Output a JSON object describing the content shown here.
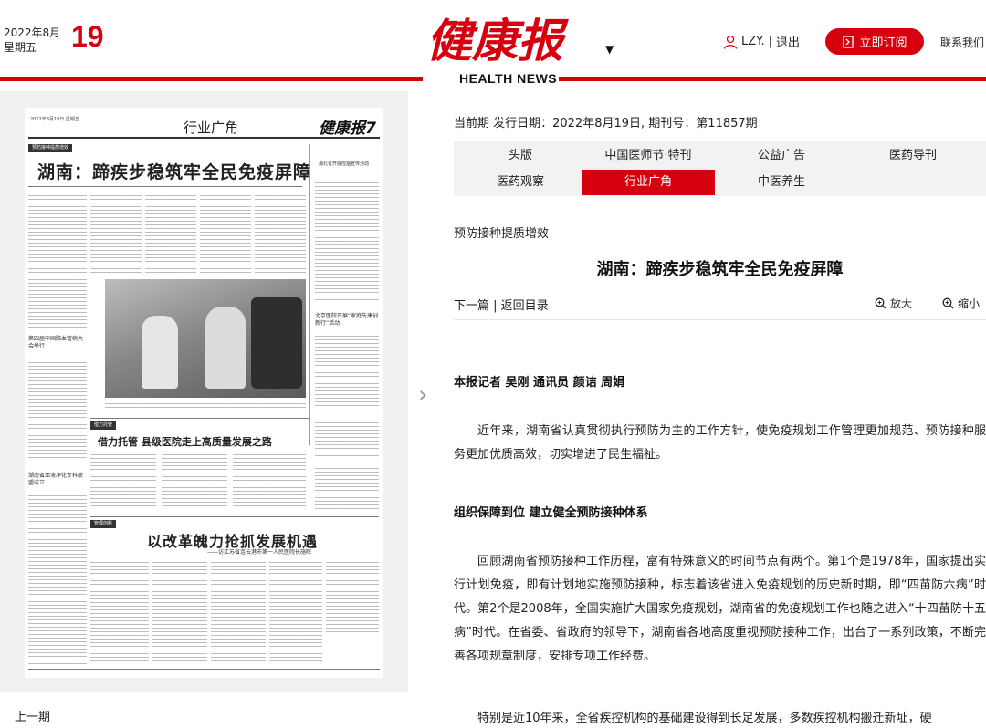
{
  "header": {
    "year_month": "2022年8月",
    "weekday": "星期五",
    "day": "19",
    "logo_text": "健康报",
    "logo_sub": "HEALTH NEWS",
    "user": "LZY.",
    "logout": "退出",
    "subscribe": "立即订阅",
    "contact": "联系我们",
    "accent": "#d7000f"
  },
  "paper": {
    "date": "2022年8月19日 星期五",
    "section": "行业广角",
    "masthead": "健康报",
    "page_no": "7",
    "tag1": "预防接种提质增效",
    "headline1": "湖南：蹄疾步稳筑牢全民免疫屏障",
    "tag2": "借力托管",
    "headline2": "借力托管 县级医院走上高质量发展之路",
    "tag3": "管理创新",
    "headline3": "以改革魄力抢抓发展机遇",
    "subhead3": "——访江苏省连云港市第一人民医院长施晖",
    "side1": "湖北省开展控烟宣传活动",
    "side2": "第四届中国脑血管病大会举行",
    "side3": "湖南省血液净化专科联盟成立",
    "side4": "北京医院开展“家庭先康创新行”活动"
  },
  "left": {
    "prev_issue": "上一期"
  },
  "content": {
    "issue_line": "当前期 发行日期：2022年8月19日, 期刊号：第11857期",
    "tabs": [
      {
        "label": "头版",
        "active": false
      },
      {
        "label": "中国医师节·特刊",
        "active": false
      },
      {
        "label": "公益广告",
        "active": false
      },
      {
        "label": "医药导刊",
        "active": false
      },
      {
        "label": "医药观察",
        "active": false
      },
      {
        "label": "行业广角",
        "active": true
      },
      {
        "label": "中医养生",
        "active": false
      }
    ],
    "subtitle": "预防接种提质增效",
    "title": "湖南：蹄疾步稳筑牢全民免疫屏障",
    "next": "下一篇",
    "back": "返回目录",
    "zoom_in": "放大",
    "zoom_out": "缩小",
    "author": "本报记者  吴刚  通讯员  颜诘  周娟",
    "para1": "近年来，湖南省认真贯彻执行预防为主的工作方针，使免疫规划工作管理更加规范、预防接种服务更加优质高效，切实增进了民生福祉。",
    "section1": "组织保障到位  建立健全预防接种体系",
    "para2": "回顾湖南省预防接种工作历程，富有特殊意义的时间节点有两个。第1个是1978年，国家提出实行计划免疫，即有计划地实施预防接种，标志着该省进入免疫规划的历史新时期，即“四苗防六病”时代。第2个是2008年，全国实施扩大国家免疫规划，湖南省的免疫规划工作也随之进入“十四苗防十五病”时代。在省委、省政府的领导下，湖南省各地高度重视预防接种工作，出台了一系列政策，不断完善各项规章制度，安排专项工作经费。",
    "para3": "特别是近10年来，全省疾控机构的基础建设得到长足发展，多数疾控机构搬迁新址，硬"
  }
}
